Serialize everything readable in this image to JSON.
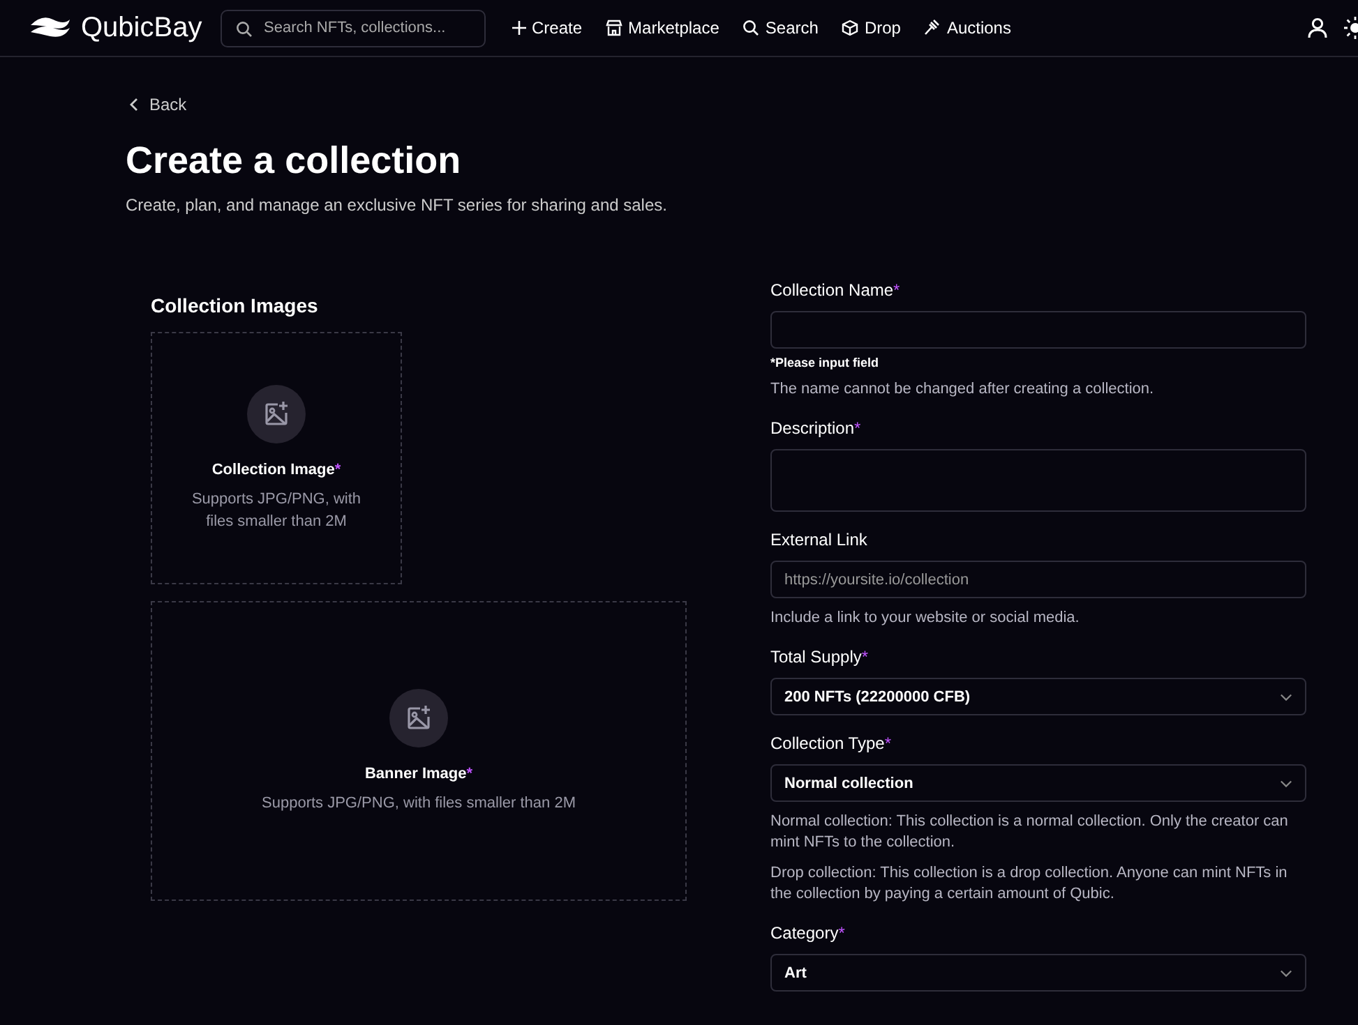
{
  "header": {
    "brand": "QubicBay",
    "search": {
      "placeholder": "Search NFTs, collections..."
    },
    "nav": [
      {
        "label": "Create",
        "kind": "plus"
      },
      {
        "label": "Marketplace",
        "kind": "store"
      },
      {
        "label": "Search",
        "kind": "search"
      },
      {
        "label": "Drop",
        "kind": "cube"
      },
      {
        "label": "Auctions",
        "kind": "gavel"
      }
    ]
  },
  "back": "Back",
  "title": "Create a collection",
  "subtitle": "Create, plan, and manage an exclusive NFT series for sharing and sales.",
  "images": {
    "heading": "Collection Images",
    "uploads": [
      {
        "label": "Collection Image",
        "required_mark": "*",
        "hint": "Supports JPG/PNG, with files smaller than 2M",
        "kind": "square"
      },
      {
        "label": "Banner Image",
        "required_mark": "*",
        "hint": "Supports JPG/PNG, with files smaller than 2M",
        "kind": "banner"
      }
    ]
  },
  "fields": [
    {
      "label": "Collection Name",
      "required_mark": "*",
      "kind": "input",
      "error": "*Please input field",
      "notes": [
        "The name cannot be changed after creating a collection."
      ]
    },
    {
      "label": "Description",
      "required_mark": "*",
      "kind": "textarea"
    },
    {
      "label": "External Link",
      "kind": "input",
      "placeholder": "https://yoursite.io/collection",
      "notes": [
        "Include a link to your website or social media."
      ]
    },
    {
      "label": "Total Supply",
      "required_mark": "*",
      "kind": "select",
      "value": "200 NFTs (22200000 CFB)"
    },
    {
      "label": "Collection Type",
      "required_mark": "*",
      "kind": "select",
      "value": "Normal collection",
      "notes": [
        "Normal collection: This collection is a normal collection. Only the creator can mint NFTs to the collection.",
        "Drop collection: This collection is a drop collection. Anyone can mint NFTs in the collection by paying a certain amount of Qubic."
      ]
    },
    {
      "label": "Category",
      "required_mark": "*",
      "kind": "select",
      "value": "Art"
    }
  ]
}
